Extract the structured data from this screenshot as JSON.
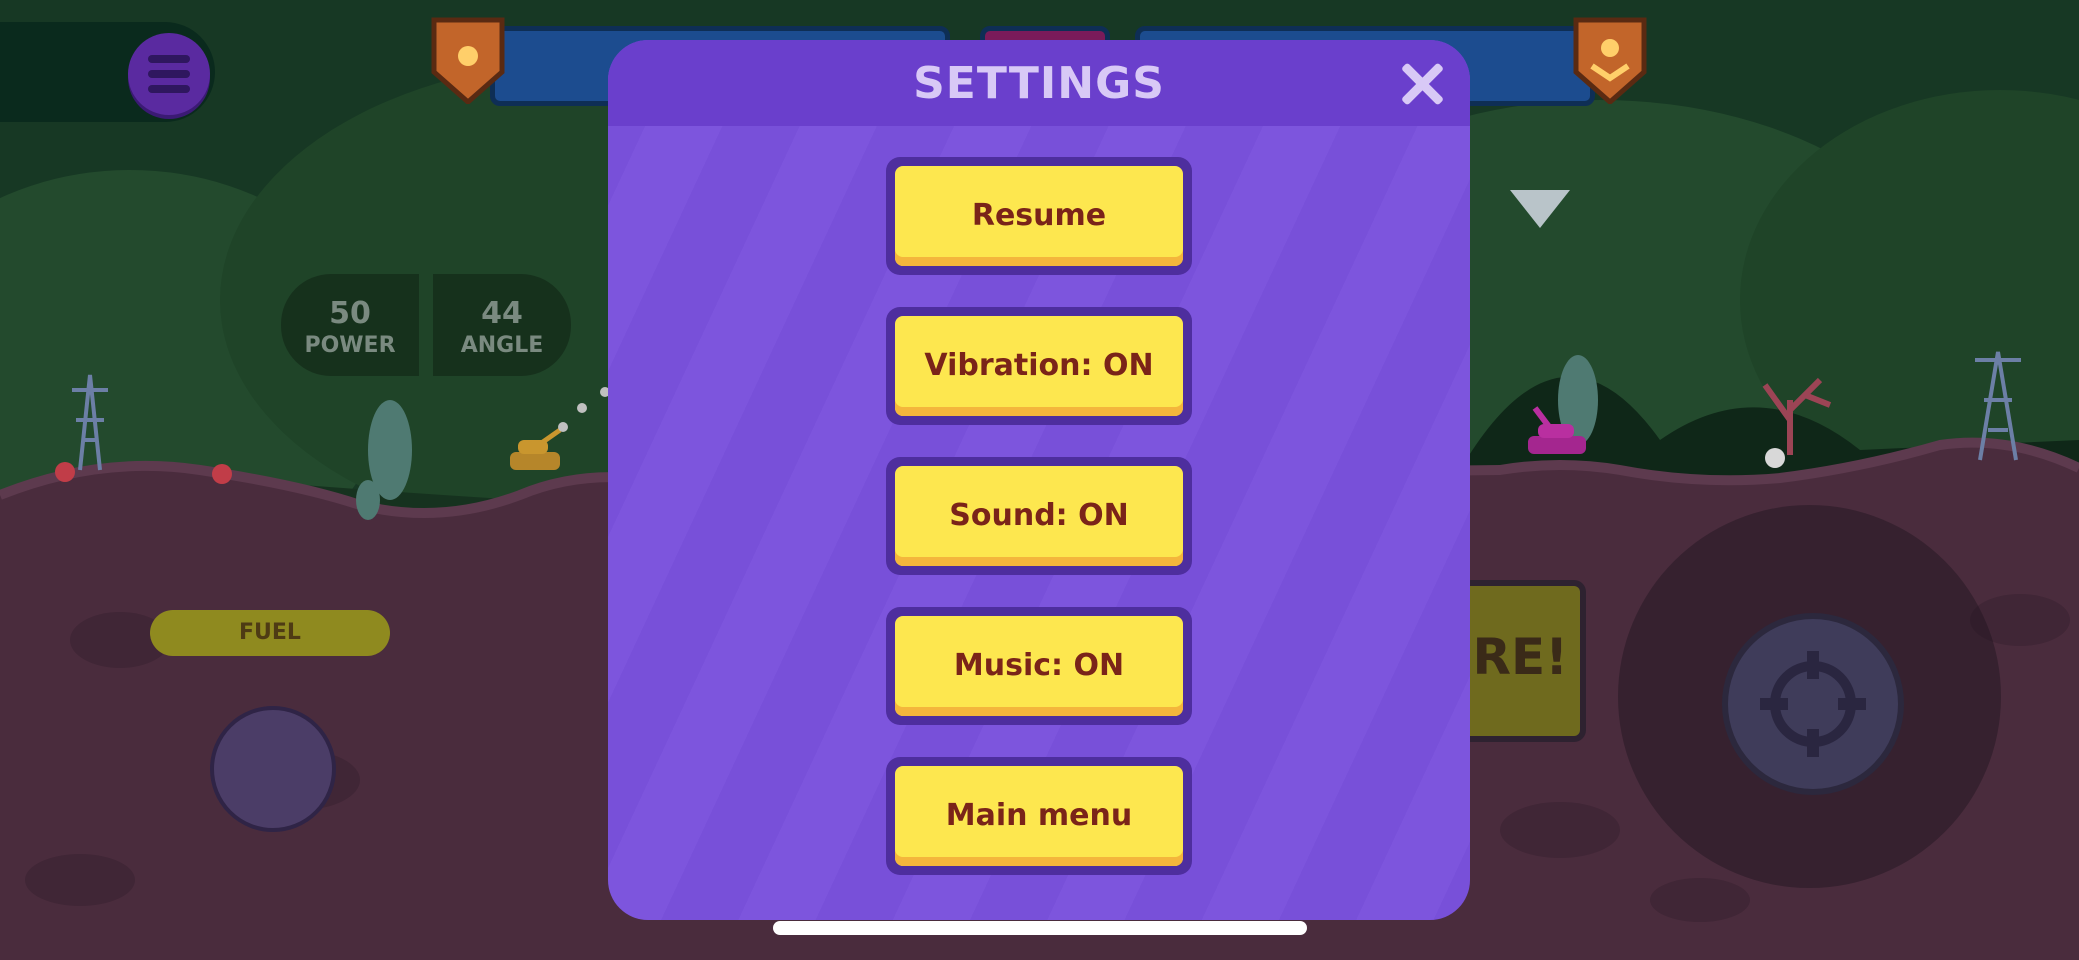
{
  "hud": {
    "power": {
      "value": "50",
      "label": "POWER"
    },
    "angle": {
      "value": "44",
      "label": "ANGLE"
    },
    "fuel_label": "FUEL",
    "fire_label": "RE!"
  },
  "settings": {
    "title": "SETTINGS",
    "buttons": [
      "Resume",
      "Vibration: ON",
      "Sound: ON",
      "Music: ON",
      "Main menu"
    ]
  },
  "colors": {
    "modal_bg": "#7850d9",
    "modal_header": "#6a3fcc",
    "button_fill": "#fde74f",
    "button_text": "#7a2419",
    "ground": "#4a2c3d"
  },
  "icons": [
    "menu-icon",
    "close-icon",
    "rank-badge-icon",
    "crosshair-icon",
    "enemy-marker-icon"
  ]
}
